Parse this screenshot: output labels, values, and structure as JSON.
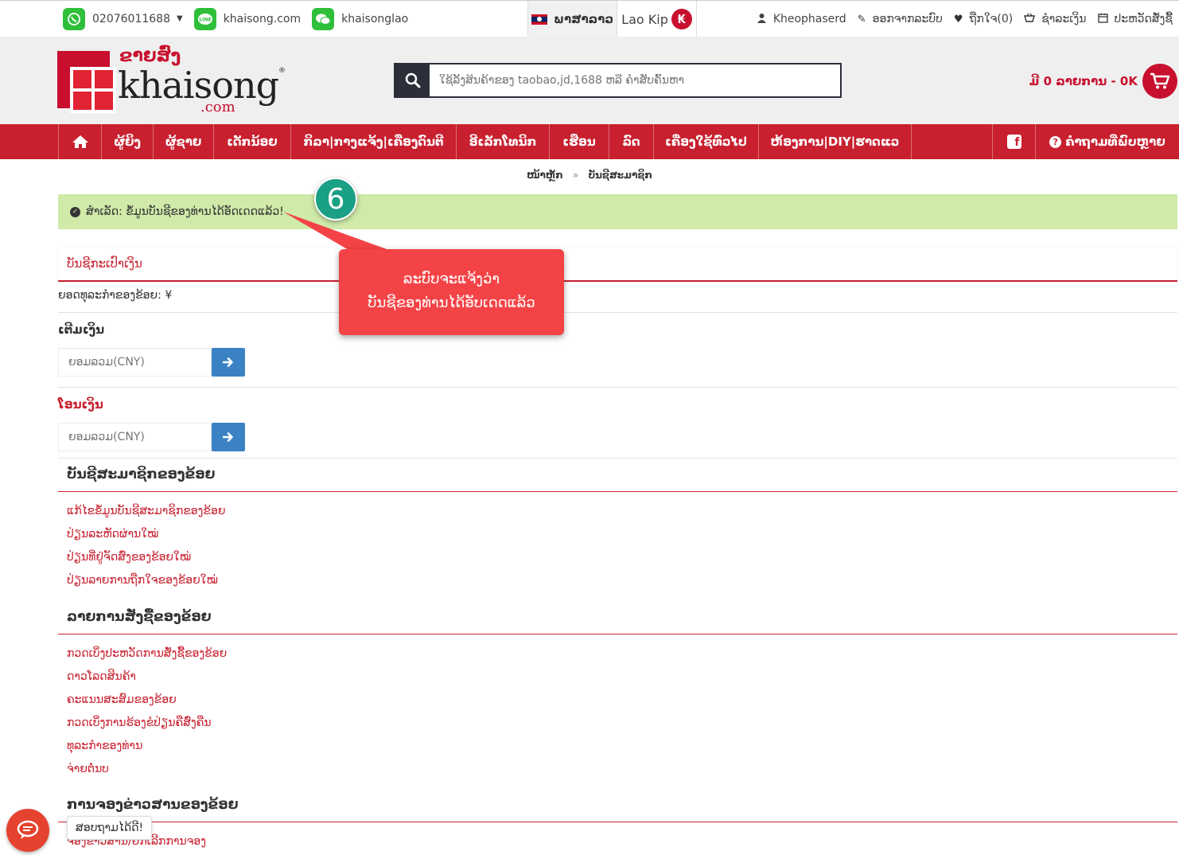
{
  "topbar": {
    "phone": "02076011688",
    "line": "khaisong.com",
    "wechat": "khaisonglao",
    "language": "ພາສາລາວ",
    "currency": "Lao Kip",
    "currency_symbol": "₭",
    "user": "Kheophaserd",
    "logout": "ອອກຈາກລະບົບ",
    "wishlist": "ຖືກໃຈ(0)",
    "checkout": "ຊຳລະເງິນ",
    "order_history": "ປະຫວັດສັ່ງຊື້"
  },
  "header": {
    "logo_lao": "ຂາຍສົ່ງ",
    "logo_name": "khaisong",
    "logo_suffix": ".com",
    "logo_reg": "®",
    "search_placeholder": "ໃຊ້ລິ້ງສິນຄ້າຂອງ taobao,jd,1688 ຫລື ຄຳສັບຄົ້ນຫາ",
    "cart_text": "ມີ 0 ລາຍການ - 0K"
  },
  "nav": {
    "items": [
      "ຜູ້ຍິງ",
      "ຜູ້ຊາຍ",
      "ເດັກນ້ອຍ",
      "ກິລາ|ກາງແຈ້ງ|ເຄື່ອງດົນຕີ",
      "ອີເລັກໂທນິກ",
      "ເຮືອນ",
      "ລົດ",
      "ເຄື່ອງໃຊ້ທົ່ວໄປ",
      "ຫ້ອງການ|DIY|ຮາດແວ"
    ],
    "facebook": "f",
    "faq": "ຄຳຖາມທີ່ພົບຫຼາຍ"
  },
  "breadcrumb": {
    "home": "ໜ້າຫຼັກ",
    "sep": "»",
    "current": "ບັນຊີສະມາຊິກ"
  },
  "alert": {
    "text": "ສຳເລັດ: ຂໍ້ມູນບັນຊີຂອງທ່ານໄດ້ອັດເດດແລ້ວ!"
  },
  "wallet": {
    "title": "ບັນຊີກະເປົາເງິນ",
    "balance": "ຍອດທຸລະກຳຂອງຂ້ອຍ: ¥",
    "topup_label": "ເຕີມເງິນ",
    "topup_placeholder": "ຍອມລວມ(CNY)",
    "transfer_label": "ໂອນເງິນ",
    "transfer_placeholder": "ຍອມລວມ(CNY)"
  },
  "sections": [
    {
      "title": "ບັນຊີສະມາຊິກຂອງຂ້ອຍ",
      "links": [
        "ແກ້ໄຂຂໍ້ມູນບັນຊີສະມາຊິກຂອງຂ້ອຍ",
        "ປ່ຽນລະຫັດຜ່ານໃໝ່",
        "ປ່ຽນທີ່ຢູ່ຈັດສົ່ງຂອງຂ້ອຍໃໝ່",
        "ປ່ຽນລາຍການຖືກໃຈຂອງຂ້ອຍໃໝ່"
      ]
    },
    {
      "title": "ລາຍການສັ່ງຊື້ຂອງຂ້ອຍ",
      "links": [
        "ກວດເບິ່ງປະຫວັດການສັ່ງຊື້ຂອງຂ້ອຍ",
        "ດາວໂລດສິນຄ້າ",
        "ຄະແນນສະສົມຂອງຂ້ອຍ",
        "ກວດເບິ່ງການຮ້ອງຂໍປ່ຽນຄືສົ່ງຄືນ",
        "ທຸລະກຳຂອງທ່ານ",
        "ຈ່າຍຕໍ່ນບ"
      ]
    },
    {
      "title": "ການຈອງຂ່າວສານຂອງຂ້ອຍ",
      "links": [
        "ຈອງຂ່າວສານ/ຍົກເລີກການຈອງ"
      ]
    }
  ],
  "annotation": {
    "step": "6",
    "line1": "ລະບົບຈະແຈ້ງວ່າ",
    "line2": "ບັນຊີຂອງທ່ານໄດ້ອັບເດດແລ້ວ"
  },
  "chat": {
    "tooltip": "ສອບຖາມໄດ້ດີ!"
  },
  "colors": {
    "brand_red": "#c8202f",
    "success_bg": "#cfeaa9",
    "callout_red": "#f44346",
    "badge_teal": "#1aa085",
    "button_blue": "#3a82c4"
  }
}
